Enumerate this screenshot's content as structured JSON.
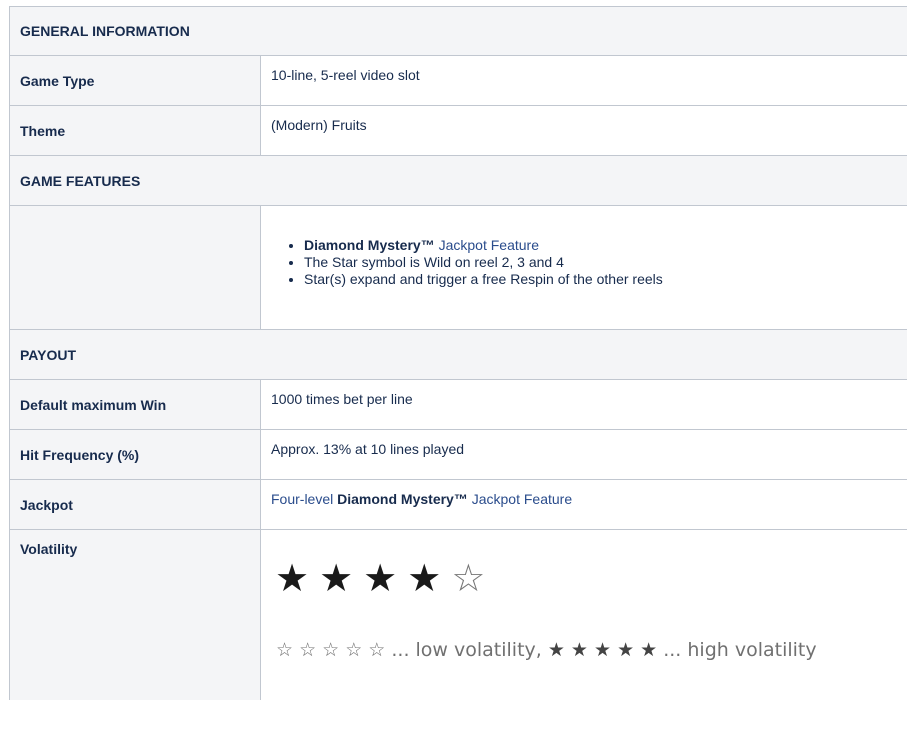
{
  "sections": {
    "general": "GENERAL INFORMATION",
    "features": "GAME FEATURES",
    "payout": "PAYOUT"
  },
  "general": {
    "game_type_label": "Game Type",
    "game_type_value": "10-line, 5-reel video slot",
    "theme_label": "Theme",
    "theme_value": "(Modern) Fruits"
  },
  "features": {
    "items": [
      {
        "bold": "Diamond Mystery™",
        "text": " Jackpot Feature"
      },
      {
        "bold": "",
        "text": "The Star symbol is Wild on reel 2, 3 and 4"
      },
      {
        "bold": "",
        "text": "Star(s) expand and trigger a free Respin of the other reels"
      }
    ]
  },
  "payout": {
    "max_win_label": "Default maximum Win",
    "max_win_value": "1000 times bet per line",
    "hit_freq_label": "Hit Frequency (%)",
    "hit_freq_value": "Approx. 13% at 10 lines played",
    "jackpot_label": "Jackpot",
    "jackpot_prefix": "Four-level ",
    "jackpot_bold": "Diamond Mystery™",
    "jackpot_suffix": " Jackpot Feature",
    "volatility_label": "Volatility",
    "volatility_rating": 4,
    "volatility_max": 5,
    "legend_low_stars": "☆ ☆ ☆ ☆ ☆",
    "legend_low_text": " ... low volatility, ",
    "legend_high_stars": "★ ★ ★ ★ ★",
    "legend_high_text": " ... high volatility"
  }
}
